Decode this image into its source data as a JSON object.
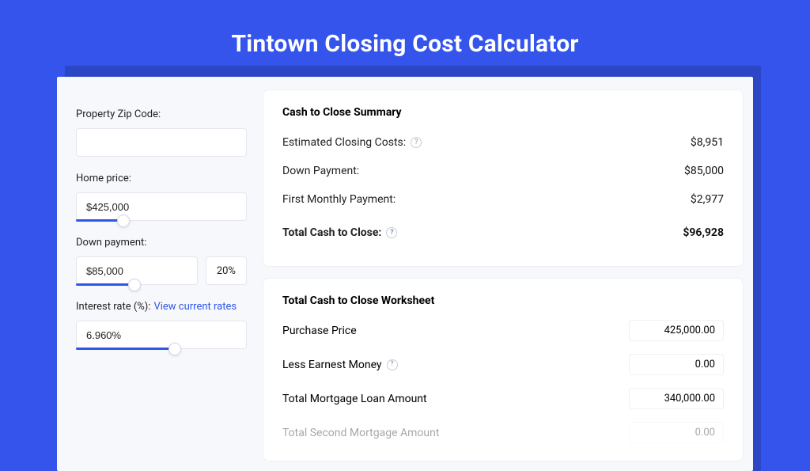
{
  "title": "Tintown Closing Cost Calculator",
  "sidebar": {
    "zip_label": "Property Zip Code:",
    "zip_value": "",
    "home_price_label": "Home price:",
    "home_price_value": "$425,000",
    "home_price_slider_pct": 28,
    "down_payment_label": "Down payment:",
    "down_payment_value": "$85,000",
    "down_payment_pct": "20%",
    "down_payment_slider_pct": 48,
    "interest_label": "Interest rate (%):",
    "interest_link": "View current rates",
    "interest_value": "6.960%",
    "interest_slider_pct": 58
  },
  "summary": {
    "heading": "Cash to Close Summary",
    "rows": [
      {
        "label": "Estimated Closing Costs:",
        "help": true,
        "value": "$8,951"
      },
      {
        "label": "Down Payment:",
        "help": false,
        "value": "$85,000"
      },
      {
        "label": "First Monthly Payment:",
        "help": false,
        "value": "$2,977"
      }
    ],
    "total_label": "Total Cash to Close:",
    "total_value": "$96,928"
  },
  "worksheet": {
    "heading": "Total Cash to Close Worksheet",
    "rows": [
      {
        "label": "Purchase Price",
        "help": false,
        "value": "425,000.00"
      },
      {
        "label": "Less Earnest Money",
        "help": true,
        "value": "0.00"
      },
      {
        "label": "Total Mortgage Loan Amount",
        "help": false,
        "value": "340,000.00"
      },
      {
        "label": "Total Second Mortgage Amount",
        "help": false,
        "value": "0.00"
      }
    ]
  }
}
